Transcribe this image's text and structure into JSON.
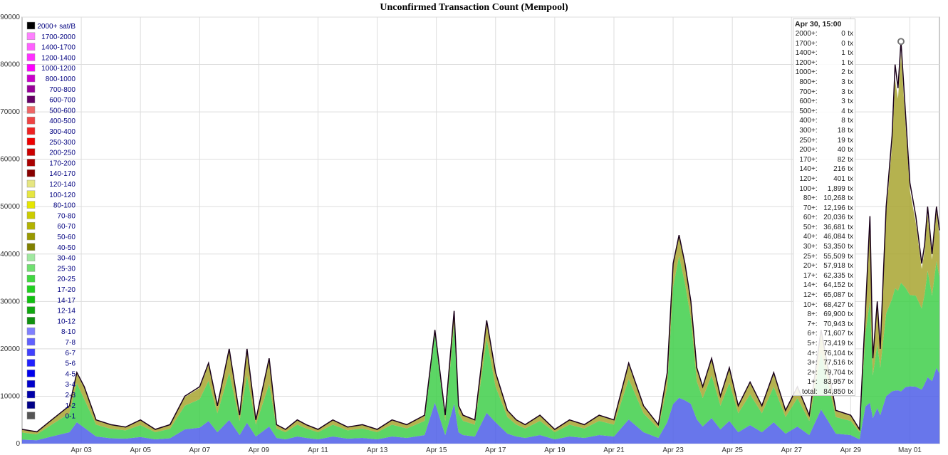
{
  "chart_data": {
    "type": "area",
    "stacked": true,
    "title": "Unconfirmed Transaction Count (Mempool)",
    "ylim": [
      0,
      90000
    ],
    "yticks": [
      0,
      10000,
      20000,
      30000,
      40000,
      50000,
      60000,
      70000,
      80000,
      90000
    ],
    "x_range": [
      "2024-04-01T10:00",
      "2024-05-01T22:00"
    ],
    "xticks": [
      "Apr 03",
      "Apr 05",
      "Apr 07",
      "Apr 09",
      "Apr 11",
      "Apr 13",
      "Apr 15",
      "Apr 17",
      "Apr 19",
      "Apr 21",
      "Apr 23",
      "Apr 25",
      "Apr 27",
      "Apr 29",
      "May 01"
    ],
    "xtick_days": [
      2,
      4,
      6,
      8,
      10,
      12,
      14,
      16,
      18,
      20,
      22,
      24,
      26,
      28,
      30
    ],
    "grid": true,
    "legend_position": "top-left",
    "legend": [
      {
        "label": "2000+ sat/B",
        "color": "#000000"
      },
      {
        "label": "1700-2000",
        "color": "#ff80ff"
      },
      {
        "label": "1400-1700",
        "color": "#ff60ff"
      },
      {
        "label": "1200-1400",
        "color": "#ff30ff"
      },
      {
        "label": "1000-1200",
        "color": "#ff00ff"
      },
      {
        "label": "800-1000",
        "color": "#cc00cc"
      },
      {
        "label": "700-800",
        "color": "#990099"
      },
      {
        "label": "600-700",
        "color": "#660066"
      },
      {
        "label": "500-600",
        "color": "#ee6666"
      },
      {
        "label": "400-500",
        "color": "#ee4444"
      },
      {
        "label": "300-400",
        "color": "#ee2222"
      },
      {
        "label": "250-300",
        "color": "#ee0000"
      },
      {
        "label": "200-250",
        "color": "#cc0000"
      },
      {
        "label": "170-200",
        "color": "#aa0000"
      },
      {
        "label": "140-170",
        "color": "#880000"
      },
      {
        "label": "120-140",
        "color": "#e6e680"
      },
      {
        "label": "100-120",
        "color": "#e6e640"
      },
      {
        "label": "80-100",
        "color": "#e6e600"
      },
      {
        "label": "70-80",
        "color": "#cccc00"
      },
      {
        "label": "60-70",
        "color": "#b3b300"
      },
      {
        "label": "50-60",
        "color": "#999900"
      },
      {
        "label": "40-50",
        "color": "#808000"
      },
      {
        "label": "30-40",
        "color": "#a0e8a0"
      },
      {
        "label": "25-30",
        "color": "#70e070"
      },
      {
        "label": "20-25",
        "color": "#40d840"
      },
      {
        "label": "17-20",
        "color": "#20d020"
      },
      {
        "label": "14-17",
        "color": "#10c010"
      },
      {
        "label": "12-14",
        "color": "#10a810"
      },
      {
        "label": "10-12",
        "color": "#109010"
      },
      {
        "label": "8-10",
        "color": "#8080ff"
      },
      {
        "label": "7-8",
        "color": "#6060ff"
      },
      {
        "label": "6-7",
        "color": "#4040ff"
      },
      {
        "label": "5-6",
        "color": "#2020ff"
      },
      {
        "label": "4-5",
        "color": "#0000ee"
      },
      {
        "label": "3-4",
        "color": "#0000cc"
      },
      {
        "label": "2-3",
        "color": "#0000aa"
      },
      {
        "label": "1-2",
        "color": "#000088"
      },
      {
        "label": "0-1",
        "color": "#555555"
      }
    ],
    "total_series": {
      "name": "total",
      "days": [
        0.0,
        0.5,
        1.0,
        1.6,
        1.85,
        2.1,
        2.5,
        3.0,
        3.5,
        4.0,
        4.5,
        5.0,
        5.5,
        6.0,
        6.3,
        6.6,
        7.0,
        7.35,
        7.6,
        7.9,
        8.35,
        8.6,
        8.9,
        9.3,
        9.6,
        10.0,
        10.5,
        11.0,
        11.5,
        12.0,
        12.5,
        13.0,
        13.6,
        13.95,
        14.3,
        14.6,
        14.75,
        14.9,
        15.3,
        15.7,
        16.0,
        16.4,
        16.7,
        17.0,
        17.5,
        18.0,
        18.5,
        19.0,
        19.5,
        20.0,
        20.5,
        21.0,
        21.5,
        21.8,
        22.0,
        22.2,
        22.4,
        22.6,
        22.8,
        23.0,
        23.3,
        23.6,
        23.9,
        24.2,
        24.6,
        25.0,
        25.4,
        25.8,
        26.2,
        26.6,
        27.0,
        27.5,
        28.0,
        28.3,
        28.5,
        28.65,
        28.75,
        28.9,
        29.0,
        29.2,
        29.4,
        29.5,
        29.6,
        29.7,
        29.85,
        30.0,
        30.2,
        30.4,
        30.5,
        30.6,
        30.75,
        30.9,
        31.0
      ],
      "values": [
        3000,
        2500,
        5000,
        8000,
        15000,
        12000,
        5000,
        4000,
        3500,
        5000,
        3000,
        4000,
        10000,
        12000,
        17000,
        8000,
        20000,
        6000,
        20000,
        5000,
        18000,
        4000,
        3000,
        5000,
        4000,
        3000,
        5000,
        3500,
        4000,
        3000,
        5000,
        4000,
        6000,
        24000,
        6000,
        28000,
        8000,
        6000,
        5000,
        26000,
        15000,
        7000,
        5000,
        4000,
        6000,
        3000,
        5000,
        4000,
        6000,
        5000,
        17000,
        8000,
        4000,
        15000,
        38000,
        44000,
        38000,
        30000,
        16000,
        12000,
        18000,
        10000,
        16000,
        8000,
        13000,
        8000,
        15000,
        7000,
        12000,
        6000,
        24000,
        7000,
        6000,
        3000,
        28000,
        48000,
        18000,
        30000,
        20000,
        50000,
        65000,
        80000,
        75000,
        84850,
        70000,
        55000,
        48000,
        38000,
        42000,
        50000,
        40000,
        50000,
        45000
      ]
    },
    "bands": [
      {
        "name": "0-8 sat/B (blue)",
        "fraction": [
          0.28,
          0.28,
          0.3,
          0.3,
          0.3,
          0.28,
          0.3,
          0.28,
          0.3,
          0.28,
          0.3,
          0.28,
          0.3,
          0.28,
          0.28,
          0.3,
          0.25,
          0.3,
          0.22,
          0.3,
          0.2,
          0.3,
          0.3,
          0.3,
          0.3,
          0.3,
          0.3,
          0.3,
          0.3,
          0.3,
          0.3,
          0.3,
          0.3,
          0.36,
          0.3,
          0.3,
          0.3,
          0.3,
          0.3,
          0.25,
          0.3,
          0.3,
          0.3,
          0.3,
          0.3,
          0.3,
          0.3,
          0.3,
          0.3,
          0.3,
          0.3,
          0.3,
          0.3,
          0.3,
          0.22,
          0.22,
          0.24,
          0.28,
          0.32,
          0.3,
          0.3,
          0.3,
          0.3,
          0.3,
          0.3,
          0.3,
          0.3,
          0.3,
          0.3,
          0.3,
          0.3,
          0.3,
          0.3,
          0.3,
          0.28,
          0.18,
          0.3,
          0.25,
          0.3,
          0.2,
          0.17,
          0.14,
          0.15,
          0.13,
          0.17,
          0.22,
          0.25,
          0.3,
          0.3,
          0.28,
          0.33,
          0.32,
          0.33
        ]
      },
      {
        "name": "8-30 sat/B (green)",
        "fraction": [
          0.5,
          0.5,
          0.5,
          0.5,
          0.55,
          0.5,
          0.5,
          0.5,
          0.5,
          0.5,
          0.5,
          0.5,
          0.5,
          0.5,
          0.5,
          0.5,
          0.5,
          0.5,
          0.5,
          0.5,
          0.5,
          0.5,
          0.5,
          0.5,
          0.5,
          0.5,
          0.5,
          0.5,
          0.5,
          0.5,
          0.5,
          0.5,
          0.5,
          0.6,
          0.5,
          0.6,
          0.5,
          0.5,
          0.5,
          0.6,
          0.5,
          0.5,
          0.5,
          0.5,
          0.5,
          0.5,
          0.5,
          0.5,
          0.5,
          0.5,
          0.5,
          0.5,
          0.5,
          0.5,
          0.65,
          0.68,
          0.65,
          0.6,
          0.5,
          0.5,
          0.5,
          0.5,
          0.5,
          0.5,
          0.5,
          0.5,
          0.5,
          0.5,
          0.5,
          0.5,
          0.5,
          0.5,
          0.5,
          0.5,
          0.55,
          0.45,
          0.5,
          0.45,
          0.5,
          0.35,
          0.3,
          0.27,
          0.28,
          0.27,
          0.3,
          0.35,
          0.4,
          0.45,
          0.45,
          0.45,
          0.45,
          0.45,
          0.45
        ]
      },
      {
        "name": "30-100 sat/B (olive)",
        "fraction": [
          0.2,
          0.2,
          0.18,
          0.18,
          0.13,
          0.2,
          0.18,
          0.2,
          0.18,
          0.2,
          0.18,
          0.2,
          0.18,
          0.2,
          0.2,
          0.18,
          0.23,
          0.18,
          0.26,
          0.18,
          0.28,
          0.18,
          0.18,
          0.18,
          0.18,
          0.18,
          0.18,
          0.18,
          0.18,
          0.18,
          0.18,
          0.18,
          0.18,
          0.02,
          0.18,
          0.08,
          0.18,
          0.18,
          0.18,
          0.13,
          0.18,
          0.18,
          0.18,
          0.18,
          0.18,
          0.18,
          0.18,
          0.18,
          0.18,
          0.18,
          0.18,
          0.18,
          0.18,
          0.18,
          0.12,
          0.09,
          0.1,
          0.1,
          0.16,
          0.18,
          0.18,
          0.18,
          0.18,
          0.18,
          0.18,
          0.18,
          0.18,
          0.18,
          0.18,
          0.18,
          0.18,
          0.18,
          0.18,
          0.18,
          0.15,
          0.35,
          0.18,
          0.28,
          0.18,
          0.42,
          0.5,
          0.55,
          0.54,
          0.57,
          0.5,
          0.4,
          0.32,
          0.22,
          0.22,
          0.24,
          0.19,
          0.21,
          0.19
        ]
      }
    ],
    "highlight": {
      "day": 29.7,
      "value": 84850
    }
  },
  "tooltip": {
    "header": "Apr 30, 15:00",
    "rows": [
      {
        "key": "2000+:",
        "value": "0",
        "unit": "tx"
      },
      {
        "key": "1700+:",
        "value": "0",
        "unit": "tx"
      },
      {
        "key": "1400+:",
        "value": "1",
        "unit": "tx"
      },
      {
        "key": "1200+:",
        "value": "1",
        "unit": "tx"
      },
      {
        "key": "1000+:",
        "value": "2",
        "unit": "tx"
      },
      {
        "key": "800+:",
        "value": "3",
        "unit": "tx"
      },
      {
        "key": "700+:",
        "value": "3",
        "unit": "tx"
      },
      {
        "key": "600+:",
        "value": "3",
        "unit": "tx"
      },
      {
        "key": "500+:",
        "value": "4",
        "unit": "tx"
      },
      {
        "key": "400+:",
        "value": "8",
        "unit": "tx"
      },
      {
        "key": "300+:",
        "value": "18",
        "unit": "tx"
      },
      {
        "key": "250+:",
        "value": "19",
        "unit": "tx"
      },
      {
        "key": "200+:",
        "value": "40",
        "unit": "tx"
      },
      {
        "key": "170+:",
        "value": "82",
        "unit": "tx"
      },
      {
        "key": "140+:",
        "value": "216",
        "unit": "tx"
      },
      {
        "key": "120+:",
        "value": "401",
        "unit": "tx"
      },
      {
        "key": "100+:",
        "value": "1,899",
        "unit": "tx"
      },
      {
        "key": "80+:",
        "value": "10,268",
        "unit": "tx"
      },
      {
        "key": "70+:",
        "value": "12,196",
        "unit": "tx"
      },
      {
        "key": "60+:",
        "value": "20,036",
        "unit": "tx"
      },
      {
        "key": "50+:",
        "value": "36,681",
        "unit": "tx"
      },
      {
        "key": "40+:",
        "value": "46,084",
        "unit": "tx"
      },
      {
        "key": "30+:",
        "value": "53,350",
        "unit": "tx"
      },
      {
        "key": "25+:",
        "value": "55,509",
        "unit": "tx"
      },
      {
        "key": "20+:",
        "value": "57,918",
        "unit": "tx"
      },
      {
        "key": "17+:",
        "value": "62,335",
        "unit": "tx"
      },
      {
        "key": "14+:",
        "value": "64,152",
        "unit": "tx"
      },
      {
        "key": "12+:",
        "value": "65,087",
        "unit": "tx"
      },
      {
        "key": "10+:",
        "value": "68,427",
        "unit": "tx"
      },
      {
        "key": "8+:",
        "value": "69,900",
        "unit": "tx"
      },
      {
        "key": "7+:",
        "value": "70,943",
        "unit": "tx"
      },
      {
        "key": "6+:",
        "value": "71,607",
        "unit": "tx"
      },
      {
        "key": "5+:",
        "value": "73,419",
        "unit": "tx"
      },
      {
        "key": "4+:",
        "value": "76,104",
        "unit": "tx"
      },
      {
        "key": "3+:",
        "value": "77,516",
        "unit": "tx"
      },
      {
        "key": "2+:",
        "value": "79,704",
        "unit": "tx"
      },
      {
        "key": "1+:",
        "value": "83,957",
        "unit": "tx"
      },
      {
        "key": "total:",
        "value": "84,850",
        "unit": "tx"
      }
    ]
  },
  "colors": {
    "band_blue": "#4e5ee8",
    "band_green": "#3fcf4a",
    "band_olive": "#a8a430",
    "total_line": "#1a001a",
    "grid": "#dddddd"
  }
}
